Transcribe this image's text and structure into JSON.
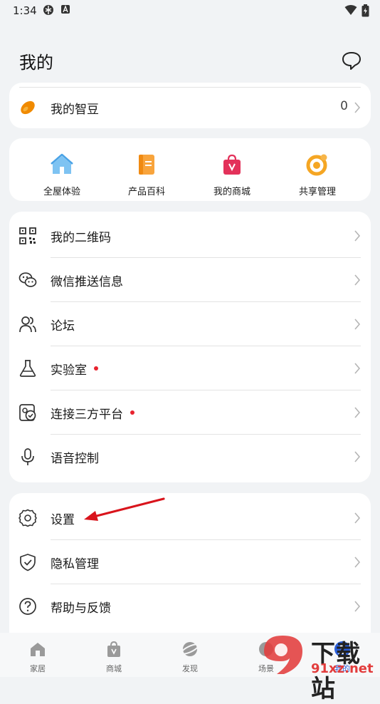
{
  "status_bar": {
    "time": "1:34"
  },
  "header": {
    "title": "我的"
  },
  "zhidou": {
    "label": "我的智豆",
    "value": "0"
  },
  "quick_actions": [
    {
      "label": "全屋体验",
      "icon": "house-icon"
    },
    {
      "label": "产品百科",
      "icon": "book-icon"
    },
    {
      "label": "我的商城",
      "icon": "shopping-bag-icon"
    },
    {
      "label": "共享管理",
      "icon": "share-icon"
    }
  ],
  "menu1": [
    {
      "label": "我的二维码",
      "icon": "qr-code-icon",
      "dot": false
    },
    {
      "label": "微信推送信息",
      "icon": "wechat-icon",
      "dot": false
    },
    {
      "label": "论坛",
      "icon": "users-icon",
      "dot": false
    },
    {
      "label": "实验室",
      "icon": "flask-icon",
      "dot": true
    },
    {
      "label": "连接三方平台",
      "icon": "link-platform-icon",
      "dot": true
    },
    {
      "label": "语音控制",
      "icon": "microphone-icon",
      "dot": false
    }
  ],
  "menu2": [
    {
      "label": "设置",
      "icon": "gear-icon"
    },
    {
      "label": "隐私管理",
      "icon": "shield-icon"
    },
    {
      "label": "帮助与反馈",
      "icon": "help-icon"
    }
  ],
  "bottom_nav": [
    {
      "label": "家居",
      "icon": "home-icon"
    },
    {
      "label": "商城",
      "icon": "bag-icon"
    },
    {
      "label": "发现",
      "icon": "planet-icon"
    },
    {
      "label": "场景",
      "icon": "scene-icon"
    },
    {
      "label": "我的",
      "icon": "me-icon"
    }
  ],
  "watermark": {
    "main": "下载站",
    "sub": "91xz.net"
  },
  "colors": {
    "accent_red": "#e8232f",
    "arrow_red": "#d9141c",
    "background": "#f1f3f5"
  }
}
